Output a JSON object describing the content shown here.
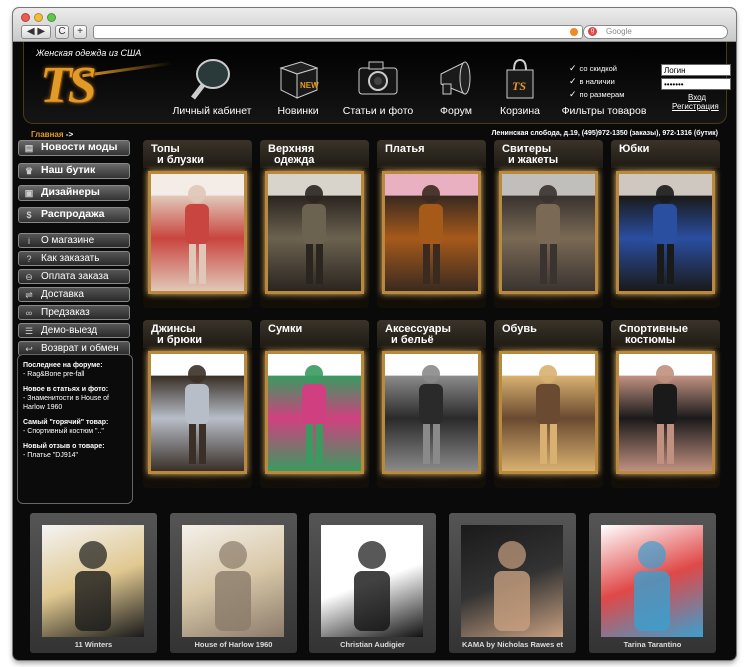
{
  "browser": {
    "back": "◀",
    "forward": "▶",
    "reload": "C",
    "add": "+",
    "search_placeholder": "Google"
  },
  "site": {
    "tagline": "Женская одежда из США",
    "logo": "TS"
  },
  "nav": [
    {
      "label": "Личный кабинет",
      "icon": "magnifier-icon"
    },
    {
      "label": "Новинки",
      "icon": "new-box-icon",
      "badge": "NEW"
    },
    {
      "label": "Статьи и фото",
      "icon": "camera-icon"
    },
    {
      "label": "Форум",
      "icon": "megaphone-icon"
    },
    {
      "label": "Корзина",
      "icon": "shopping-bag-icon"
    },
    {
      "label": "Фильтры товаров",
      "icon": "checklist-icon"
    }
  ],
  "filters": [
    "со скидкой",
    "в наличии",
    "по размерам"
  ],
  "login": {
    "login_value": "Логин",
    "password_value": "•••••••",
    "enter": "Вход",
    "register": "Регистрация"
  },
  "breadcrumb": {
    "home": "Главная",
    "arrow": "->"
  },
  "contacts": "Ленинская слобода, д.19, (495)972-1350 (заказы), 972-1316 (бутик)",
  "sidebar": {
    "main": [
      {
        "label": "Новости моды",
        "icon": "newspaper-icon",
        "glyph": "▤"
      },
      {
        "label": "Наш бутик",
        "icon": "dress-icon",
        "glyph": "♛"
      },
      {
        "label": "Дизайнеры",
        "icon": "id-card-icon",
        "glyph": "▣"
      },
      {
        "label": "Распродажа",
        "icon": "dollar-icon",
        "glyph": "$"
      }
    ],
    "info": [
      {
        "label": "О магазине",
        "icon": "info-icon",
        "glyph": "i"
      },
      {
        "label": "Как заказать",
        "icon": "question-icon",
        "glyph": "?"
      },
      {
        "label": "Оплата заказа",
        "icon": "coins-icon",
        "glyph": "⊖"
      },
      {
        "label": "Доставка",
        "icon": "car-icon",
        "glyph": "⇌"
      },
      {
        "label": "Предзаказ",
        "icon": "glasses-icon",
        "glyph": "∞"
      },
      {
        "label": "Демо-выезд",
        "icon": "list-icon",
        "glyph": "☰"
      },
      {
        "label": "Возврат и обмен",
        "icon": "return-icon",
        "glyph": "↩"
      }
    ]
  },
  "news": [
    {
      "heading": "Последнее на форуме:",
      "text": "- Rag&Bone pre-fall"
    },
    {
      "heading": "Новое в статьях и фото:",
      "text": "- Знаменитости в House of Harlow 1960"
    },
    {
      "heading": "Самый \"горячий\" товар:",
      "text": "- Спортивный костюм \"..\""
    },
    {
      "heading": "Новый отзыв о товаре:",
      "text": "- Платье \"DJ914\""
    }
  ],
  "categories": [
    {
      "line1": "Топы",
      "line2": "и блузки",
      "colors": [
        "#f4ece6",
        "#c9453f",
        "#e0c8b8"
      ]
    },
    {
      "line1": "Верхняя",
      "line2": "одежда",
      "colors": [
        "#d8d4cc",
        "#6b6250",
        "#2b2520"
      ]
    },
    {
      "line1": "Платья",
      "line2": "",
      "colors": [
        "#e8b0c0",
        "#a65a1a",
        "#3a2a20"
      ]
    },
    {
      "line1": "Свитеры",
      "line2": "и жакеты",
      "colors": [
        "#c0bfbb",
        "#7a6a55",
        "#3a3330"
      ]
    },
    {
      "line1": "Юбки",
      "line2": "",
      "colors": [
        "#cfc8c0",
        "#2a4ea0",
        "#1a1a1a"
      ]
    },
    {
      "line1": "Джинсы",
      "line2": "и брюки",
      "colors": [
        "#ffffff",
        "#b8bec8",
        "#3a3028"
      ]
    },
    {
      "line1": "Сумки",
      "line2": "",
      "colors": [
        "#ffffff",
        "#d04080",
        "#3a9a60"
      ]
    },
    {
      "line1": "Аксессуары",
      "line2": "и бельё",
      "colors": [
        "#ffffff",
        "#2a2a2a",
        "#8a8a8a"
      ]
    },
    {
      "line1": "Обувь",
      "line2": "",
      "colors": [
        "#ffffff",
        "#6a4a30",
        "#d8b070"
      ]
    },
    {
      "line1": "Спортивные",
      "line2": "костюмы",
      "colors": [
        "#ffffff",
        "#1a1a1a",
        "#c09080"
      ]
    }
  ],
  "blog": [
    {
      "caption": "11 Winters",
      "colors": [
        "#f4f4f4",
        "#e0c890",
        "#1a1a1a"
      ]
    },
    {
      "caption": "House of Harlow 1960",
      "colors": [
        "#f4f0ea",
        "#d8c8a8",
        "#8a7a6a"
      ]
    },
    {
      "caption": "Christian Audigier",
      "colors": [
        "#ffffff",
        "#ffffff",
        "#111111"
      ]
    },
    {
      "caption": "KAMA by Nicholas Rawes et",
      "colors": [
        "#1a1a1a",
        "#333333",
        "#c8a080"
      ]
    },
    {
      "caption": "Tarina Tarantino",
      "colors": [
        "#ffffff",
        "#e04848",
        "#3aa0d0"
      ]
    }
  ],
  "colors": {
    "accent": "#e39b27",
    "frame": "#b98a3e"
  }
}
